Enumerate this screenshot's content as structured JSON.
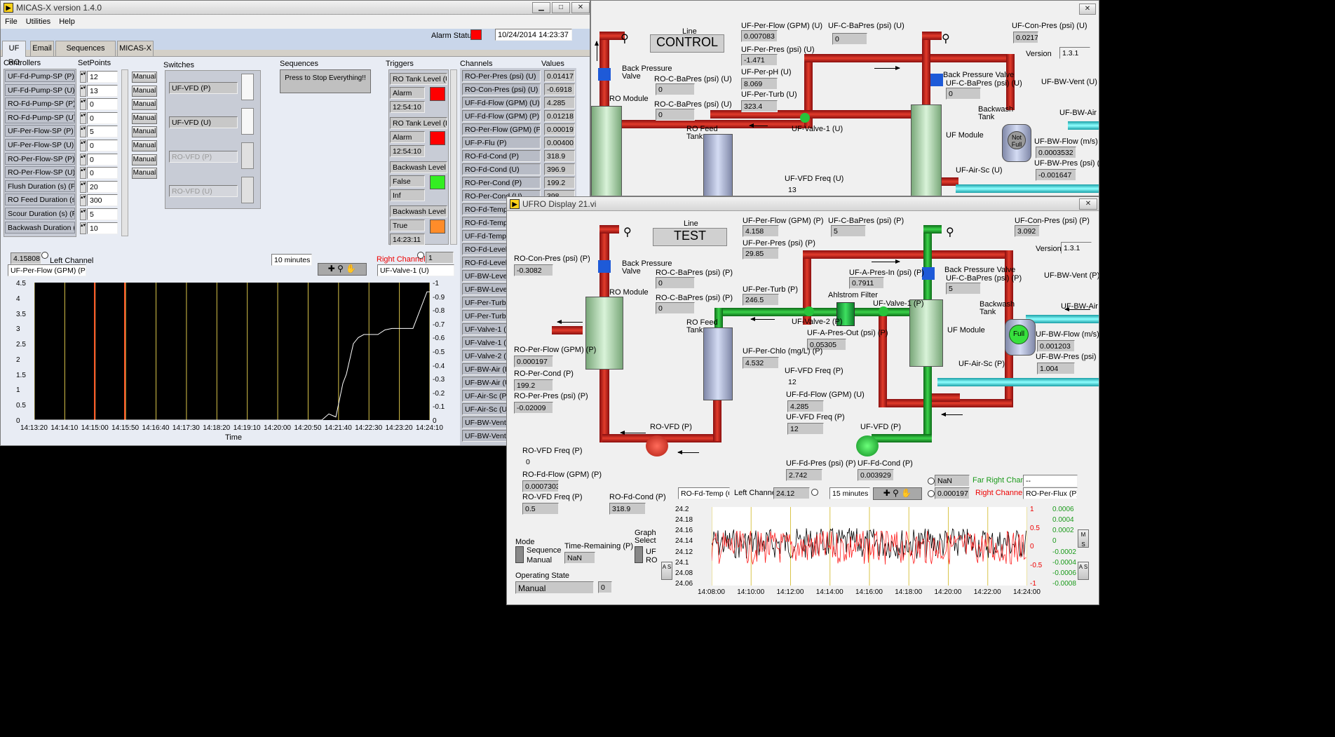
{
  "win1": {
    "title": "MICAS-X   version 1.4.0",
    "menu": [
      "File",
      "Utilities",
      "Help"
    ],
    "alarm_label": "Alarm Status",
    "datetime": "10/24/2014 14:23:37",
    "tabs": [
      "UF RO",
      "Email",
      "Sequences Display",
      "MICAS-X"
    ],
    "headers": {
      "controllers": "Controllers",
      "setpoints": "SetPoints",
      "switches": "Switches",
      "sequences": "Sequences",
      "triggers": "Triggers",
      "channels": "Channels",
      "values": "Values"
    },
    "controllers": [
      "UF-Fd-Pump-SP (P)",
      "UF-Fd-Pump-SP (U)",
      "RO-Fd-Pump-SP (P)",
      "RO-Fd-Pump-SP (U)",
      "UF-Per-Flow-SP (P)",
      "UF-Per-Flow-SP (U)",
      "RO-Per-Flow-SP (P)",
      "RO-Per-Flow-SP (U)",
      "Flush Duration (s) (P)",
      "RO Feed Duration (s)",
      "Scour Duration (s) (P)",
      "Backwash Duration (s)"
    ],
    "setpoints": [
      "12",
      "13",
      "0",
      "0",
      "5",
      "0",
      "0",
      "0",
      "20",
      "300",
      "5",
      "10"
    ],
    "manual_label": "Manual",
    "switches": [
      "UF-VFD (P)",
      "UF-VFD (U)",
      "RO-VFD (P)",
      "RO-VFD (U)"
    ],
    "sequence_button": "Press to Stop  Everything!!",
    "triggers": [
      {
        "name": "RO Tank Level (U)",
        "state": "Alarm",
        "time": "12:54:10",
        "color": "#ff0000"
      },
      {
        "name": "RO Tank Level (P)",
        "state": "Alarm",
        "time": "12:54:10",
        "color": "#ff0000"
      },
      {
        "name": "Backwash Level",
        "state": "False",
        "time": "Inf",
        "color": "#33ee22"
      },
      {
        "name": "Backwash Level",
        "state": "True",
        "time": "14:23:11",
        "color": "#ff8c2a"
      }
    ],
    "channels": [
      "RO-Per-Pres (psi) (U)",
      "RO-Con-Pres (psi) (U)",
      "UF-Fd-Flow (GPM) (U)",
      "UF-Fd-Flow (GPM) (P)",
      "RO-Per-Flow (GPM) (P)",
      "UF-P-Flu (P)",
      "RO-Fd-Cond (P)",
      "RO-Fd-Cond (U)",
      "RO-Per-Cond (P)",
      "RO-Per-Cond (U)",
      "RO-Fd-Temp (C)",
      "RO-Fd-Temp (C)",
      "UF-Fd-Temp (C)",
      "RO-Fd-Level (P)",
      "RO-Fd-Level (U)",
      "UF-BW-Level (P)",
      "UF-BW-Level (U)",
      "UF-Per-Turb (P)",
      "UF-Per-Turb (U)",
      "UF-Valve-1 (U)",
      "UF-Valve-1 (P)",
      "UF-Valve-2 (P)",
      "UF-BW-Air (P)",
      "UF-BW-Air (U)",
      "UF-Air-Sc (P)",
      "UF-Air-Sc (U)",
      "UF-BW-Vent (P)",
      "UF-BW-Vent (U)"
    ],
    "values": [
      "0.01417",
      "-0.6918",
      "4.285",
      "0.01218",
      "0.000197",
      "0.004001",
      "318.9",
      "396.9",
      "199.2",
      "398"
    ],
    "left_value": "4.15808",
    "left_channel_label": "Left Channel",
    "left_channel": "UF-Per-Flow (GPM) (P)",
    "window": "10 minutes",
    "right_channel_label": "Right Channel",
    "right_value": "1",
    "right_channel": "UF-Valve-1 (U)",
    "time_axis": "Time"
  },
  "chart_data": [
    {
      "type": "line",
      "xlabel": "Time",
      "x_ticks": [
        "14:13:20",
        "14:14:10",
        "14:15:00",
        "14:15:50",
        "14:16:40",
        "14:17:30",
        "14:18:20",
        "14:19:10",
        "14:20:00",
        "14:20:50",
        "14:21:40",
        "14:22:30",
        "14:23:20",
        "14:24:10"
      ],
      "y_ticks_left": [
        "0",
        "0.5",
        "1",
        "1.5",
        "2",
        "2.5",
        "3",
        "3.5",
        "4",
        "4.5"
      ],
      "y_ticks_right": [
        "0",
        "-0.1",
        "-0.2",
        "-0.3",
        "-0.4",
        "-0.5",
        "-0.6",
        "-0.7",
        "-0.8",
        "-0.9",
        "-1"
      ],
      "ylim_left": [
        0,
        4.5
      ],
      "ylim_right": [
        -1,
        0
      ],
      "series": [
        {
          "name": "UF-Per-Flow (GPM) (P)",
          "color": "#ffffff",
          "x": [
            0,
            410,
            420,
            430,
            440,
            445,
            450,
            455,
            462,
            470,
            480,
            490,
            500,
            510,
            515,
            520,
            525,
            530,
            535,
            540,
            560
          ],
          "y": [
            0,
            0,
            0.2,
            0.1,
            1.2,
            1.5,
            2.0,
            2.5,
            2.7,
            2.8,
            2.8,
            2.8,
            2.95,
            3.0,
            3.0,
            3.0,
            3.0,
            3.0,
            3.0,
            3.0,
            4.2
          ]
        }
      ]
    },
    {
      "type": "line",
      "x_ticks": [
        "14:08:00",
        "14:10:00",
        "14:12:00",
        "14:14:00",
        "14:16:00",
        "14:18:00",
        "14:20:00",
        "14:22:00",
        "14:24:00"
      ],
      "y_ticks_left": [
        "24.06",
        "24.08",
        "24.1",
        "24.12",
        "24.14",
        "24.16",
        "24.18",
        "24.2"
      ],
      "y_ticks_mid": [
        "-1",
        "-0.5",
        "0",
        "0.5",
        "1"
      ],
      "y_ticks_right": [
        "-0.0008",
        "-0.0006",
        "-0.0004",
        "-0.0002",
        "0",
        "0.0002",
        "0.0004",
        "0.0006"
      ],
      "ylim_left": [
        24.06,
        24.2
      ],
      "series": [
        {
          "name": "RO-Fd-Temp (C)",
          "color": "#000000"
        },
        {
          "name": "RO-Per-Flux (P)",
          "color": "#ff2020"
        }
      ]
    }
  ],
  "win2": {
    "line_label": "Line",
    "line_name": "CONTROL",
    "version_label": "Version",
    "version": "1.3.1",
    "labels": {
      "uf_per_flow": "UF-Per-Flow (GPM) (U)",
      "uf_per_pres": "UF-Per-Pres (psi) (U)",
      "uf_per_ph": "UF-Per-pH (U)",
      "uf_per_turb": "UF-Per-Turb (U)",
      "uf_c_bapres": "UF-C-BaPres (psi) (U)",
      "uf_con_pres": "UF-Con-Pres (psi) (U)",
      "ro_c_bapres1": "RO-C-BaPres (psi) (U)",
      "ro_c_bapres2": "RO-C-BaPres (psi) (U)",
      "back_pressure": "Back Pressure\nValve",
      "ro_module": "RO Module",
      "ro_feed_tank": "RO Feed\nTank",
      "uf_valve1": "UF-Valve-1 (U)",
      "uf_module": "UF Module",
      "bp_valve2": "Back Pressure Valve",
      "uf_c_bapres2": "UF-C-BaPres (psi) (U)",
      "backwash_tank": "Backwash\nTank",
      "not_full": "Not\nFull",
      "uf_bw_vent": "UF-BW-Vent (U)",
      "uf_bw_air": "UF-BW-Air (U)",
      "uf_bw_flow": "UF-BW-Flow (m/s) (U)",
      "uf_bw_pres": "UF-BW-Pres (psi) (U)",
      "uf_air_sc": "UF-Air-Sc (U)",
      "uf_vfd_freq": "UF-VFD Freq (U)"
    },
    "values": {
      "uf_per_flow": "0.007083",
      "uf_per_pres": "-1.471",
      "uf_per_ph": "8.069",
      "uf_per_turb": "323.4",
      "uf_c_bapres": "0",
      "uf_con_pres": "0.02176",
      "ro_c_bapres1": "0",
      "ro_c_bapres2": "0",
      "uf_c_bapres2": "0",
      "uf_bw_flow": "0.0003532",
      "uf_bw_pres": "-0.001647",
      "uf_vfd_freq": "13"
    }
  },
  "win3": {
    "title": "UFRO Display 21.vi",
    "line_label": "Line",
    "line_name": "TEST",
    "version_label": "Version",
    "version": "1.3.1",
    "labels": {
      "uf_per_flow": "UF-Per-Flow (GPM) (P)",
      "uf_per_pres": "UF-Per-Pres (psi) (P)",
      "uf_c_bapres": "UF-C-BaPres (psi) (P)",
      "uf_con_pres": "UF-Con-Pres (psi) (P)",
      "ro_con_pres": "RO-Con-Pres (psi) (P)",
      "back_pressure": "Back Pressure\nValve",
      "ro_c_bapres1": "RO-C-BaPres (psi) (P)",
      "ro_c_bapres2": "RO-C-BaPres (psi) (P)",
      "ro_module": "RO Module",
      "uf_a_pres_in": "UF-A-Pres-In (psi) (P)",
      "ahlstrom": "Ahlstrom Filter",
      "uf_per_turb": "UF-Per-Turb (P)",
      "ro_feed_tank": "RO Feed\nTank",
      "uf_valve2": "UF-Valve-2 (P)",
      "uf_valve1": "UF-Valve-1 (P)",
      "uf_a_pres_out": "UF-A-Pres-Out (psi) (P)",
      "uf_module": "UF Module",
      "bp_valve2": "Back Pressure Valve",
      "uf_c_bapres2": "UF-C-BaPres (psi) (P)",
      "backwash_tank": "Backwash\nTank",
      "full": "Full",
      "uf_bw_vent": "UF-BW-Vent (P)",
      "uf_bw_air": "UF-BW-Air (P)",
      "uf_bw_flow": "UF-BW-Flow (m/s) (P)",
      "uf_bw_pres": "UF-BW-Pres (psi) (P)",
      "uf_air_sc": "UF-Air-Sc (P)",
      "ro_per_flow": "RO-Per-Flow (GPM) (P)",
      "ro_per_cond": "RO-Per-Cond (P)",
      "ro_per_pres": "RO-Per-Pres (psi) (P)",
      "uf_per_chlo": "UF-Per-Chlo (mg/L) (P)",
      "uf_vfd_freq": "UF-VFD Freq (P)",
      "uf_fd_flow": "UF-Fd-Flow (GPM) (U)",
      "uf_vfd_freq2": "UF-VFD Freq (P)",
      "ro_vfd": "RO-VFD (P)",
      "uf_vfd": "UF-VFD (P)",
      "ro_vfd_freq": "RO-VFD Freq (P)",
      "ro_fd_flow": "RO-Fd-Flow (GPM) (P)",
      "ro_vfd_freq2": "RO-VFD Freq (P)",
      "ro_fd_cond": "RO-Fd-Cond (P)",
      "uf_fd_pres": "UF-Fd-Pres (psi) (P)",
      "uf_fd_cond": "UF-Fd-Cond (P)"
    },
    "values": {
      "uf_per_flow": "4.158",
      "uf_per_pres": "29.85",
      "uf_c_bapres": "5",
      "uf_con_pres": "3.092",
      "ro_con_pres": "-0.3082",
      "ro_c_bapres1": "0",
      "ro_c_bapres2": "0",
      "uf_a_pres_in": "0.7911",
      "uf_per_turb": "246.5",
      "uf_a_pres_out": "0.05305",
      "uf_c_bapres2": "5",
      "uf_bw_flow": "0.001203",
      "uf_bw_pres": "1.004",
      "ro_per_flow": "0.000197",
      "ro_per_cond": "199.2",
      "ro_per_pres": "-0.02009",
      "uf_per_chlo": "4.532",
      "uf_vfd_freq": "12",
      "uf_fd_flow": "4.285",
      "uf_vfd_freq2": "12",
      "ro_vfd_freq": "0",
      "ro_fd_flow": "0.0007303",
      "ro_vfd_freq2": "0.5",
      "ro_fd_cond": "318.9",
      "uf_fd_pres": "2.742",
      "uf_fd_cond": "0.003929"
    },
    "graph": {
      "left_sel": "RO-Fd-Temp (C)",
      "left_label": "Left Channel",
      "left_value": "24.12",
      "window": "15 minutes",
      "far_right_val": "NaN",
      "far_right_label": "Far Right Chan",
      "far_right_sel": "--",
      "right_val": "0.000197",
      "right_label": "Right Channel",
      "right_sel": "RO-Per-Flux (P)"
    },
    "mode_label": "Mode",
    "mode_opts": [
      "Sequence",
      "Manual"
    ],
    "time_remaining_label": "Time-Remaining (P)",
    "time_remaining": "NaN",
    "graph_select_label": "Graph\nSelect",
    "graph_opts": [
      "UF",
      "RO"
    ],
    "operating_state_label": "Operating State",
    "operating_state": "Manual",
    "operating_code": "0"
  }
}
